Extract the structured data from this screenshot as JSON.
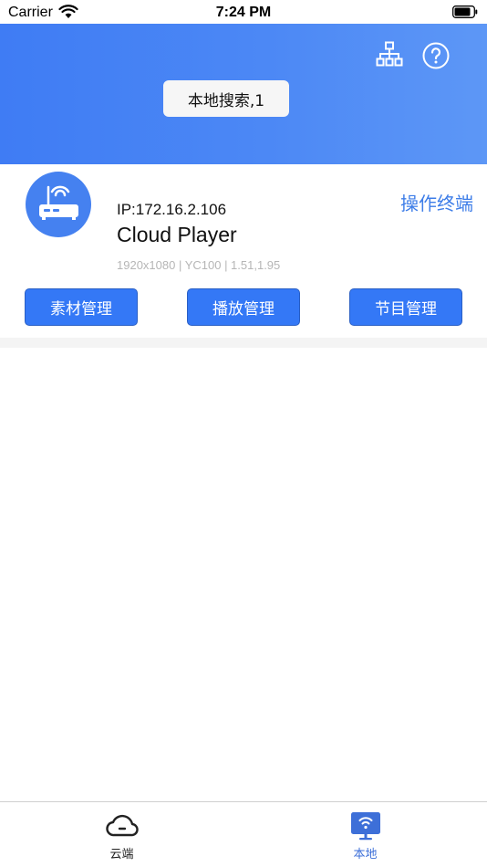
{
  "status_bar": {
    "carrier": "Carrier",
    "time": "7:24 PM"
  },
  "header": {
    "search_button_label": "本地搜索,1",
    "icons": [
      "topology-icon",
      "help-icon"
    ]
  },
  "device": {
    "ip": "IP:172.16.2.106",
    "name": "Cloud Player",
    "specs": "1920x1080 | YC100 | 1.51,1.95",
    "operate_label": "操作终端",
    "icon": "router-icon"
  },
  "actions": {
    "material_label": "素材管理",
    "playback_label": "播放管理",
    "program_label": "节目管理"
  },
  "tab_bar": {
    "tabs": [
      {
        "label": "云端",
        "icon": "cloud-icon",
        "active": false
      },
      {
        "label": "本地",
        "icon": "local-display-icon",
        "active": true
      }
    ]
  },
  "colors": {
    "header_gradient_start": "#3f7cf4",
    "header_gradient_end": "#5d97f6",
    "button_blue": "#3478f6",
    "link_blue": "#3d7de8",
    "active_tab": "#3d6fd8"
  }
}
